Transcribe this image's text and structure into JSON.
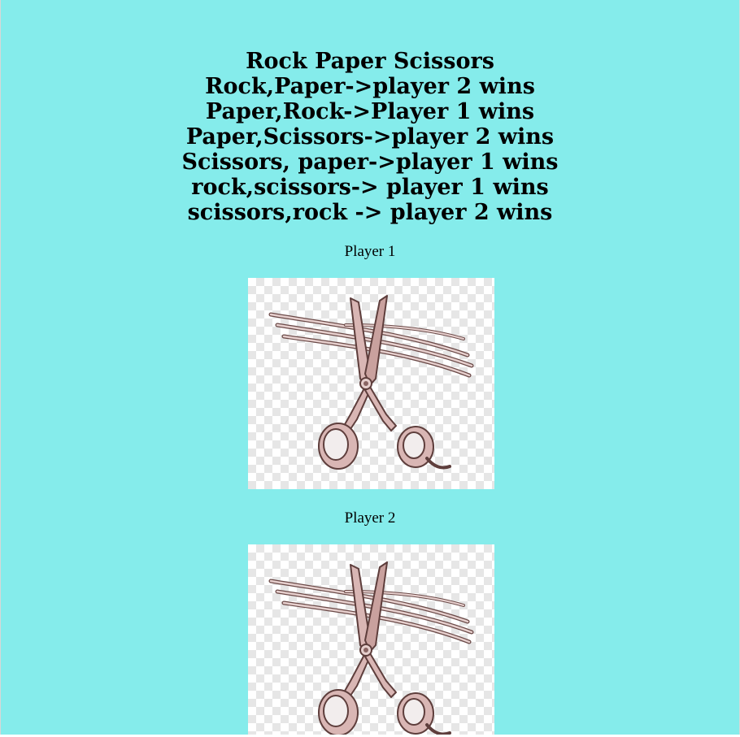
{
  "page": {
    "background_color": "#85eceb"
  },
  "header": {
    "lines": [
      "Rock Paper Scissors",
      "Rock,Paper->player 2 wins",
      "Paper,Rock->Player 1 wins",
      "Paper,Scissors->player 2 wins",
      "Scissors, paper->player 1 wins",
      "rock,scissors-> player 1 wins",
      "scissors,rock -> player 2 wins"
    ]
  },
  "player1": {
    "label": "Player 1",
    "choice_icon": "scissors-icon"
  },
  "player2": {
    "label": "Player 2",
    "choice_icon": "scissors-icon"
  },
  "colors": {
    "scissors_fill": "#d9b6b4",
    "scissors_outline": "#6b4a48"
  }
}
